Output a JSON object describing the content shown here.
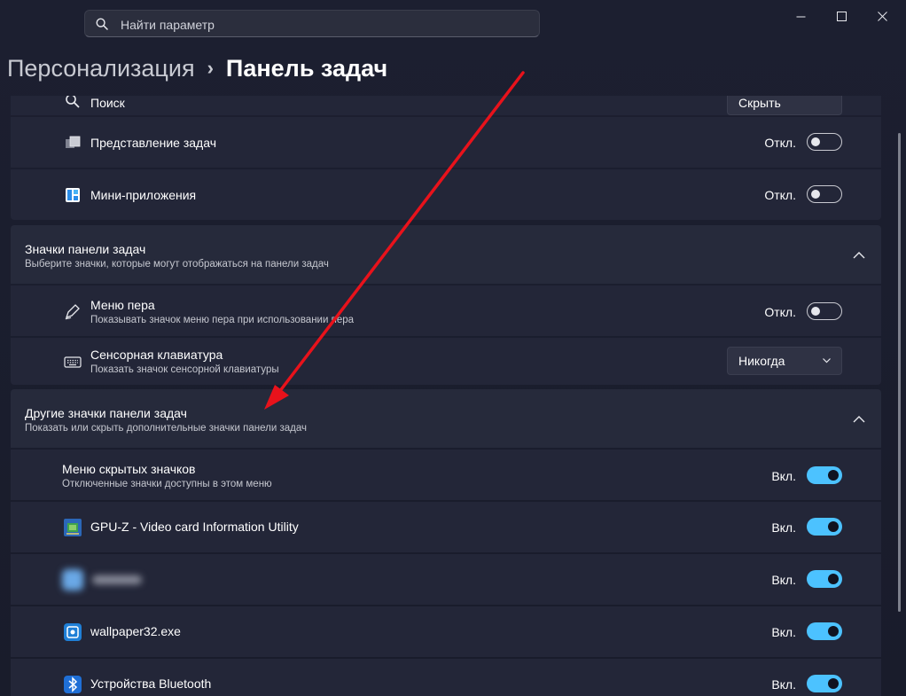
{
  "search": {
    "placeholder": "Найти параметр",
    "icon": "search-icon"
  },
  "window_controls": [
    "minimize-icon",
    "maximize-icon",
    "close-icon"
  ],
  "breadcrumb": {
    "parent": "Персонализация",
    "separator": "›",
    "current": "Панель задач"
  },
  "taskbar_items": {
    "search_row": {
      "label": "Поиск",
      "value": "Скрыть"
    },
    "task_view": {
      "label": "Представление задач",
      "state": "Откл.",
      "on": false
    },
    "widgets": {
      "label": "Мини-приложения",
      "state": "Откл.",
      "on": false
    }
  },
  "taskbar_icons": {
    "title": "Значки панели задач",
    "subtitle": "Выберите значки, которые могут отображаться на панели задач",
    "pen_menu": {
      "label": "Меню пера",
      "sub": "Показывать значок меню пера при использовании пера",
      "state": "Откл.",
      "on": false
    },
    "touch_keyboard": {
      "label": "Сенсорная клавиатура",
      "sub": "Показать значок сенсорной клавиатуры",
      "value": "Никогда"
    }
  },
  "other_icons": {
    "title": "Другие значки панели задач",
    "subtitle": "Показать или скрыть дополнительные значки панели задач",
    "hidden_menu": {
      "label": "Меню скрытых значков",
      "sub": "Отключенные значки доступны в этом меню",
      "state": "Вкл.",
      "on": true
    },
    "gpuz": {
      "label": "GPU-Z - Video card Information Utility",
      "state": "Вкл.",
      "on": true
    },
    "blurred": {
      "state": "Вкл.",
      "on": true
    },
    "wallpaper": {
      "label": "wallpaper32.exe",
      "state": "Вкл.",
      "on": true
    },
    "bluetooth": {
      "label": "Устройства Bluetooth",
      "state": "Вкл.",
      "on": true
    }
  },
  "colors": {
    "accent": "#4cc2ff",
    "annotation_arrow": "#e8121b",
    "card": "#232638",
    "background": "#1a1d2e"
  }
}
